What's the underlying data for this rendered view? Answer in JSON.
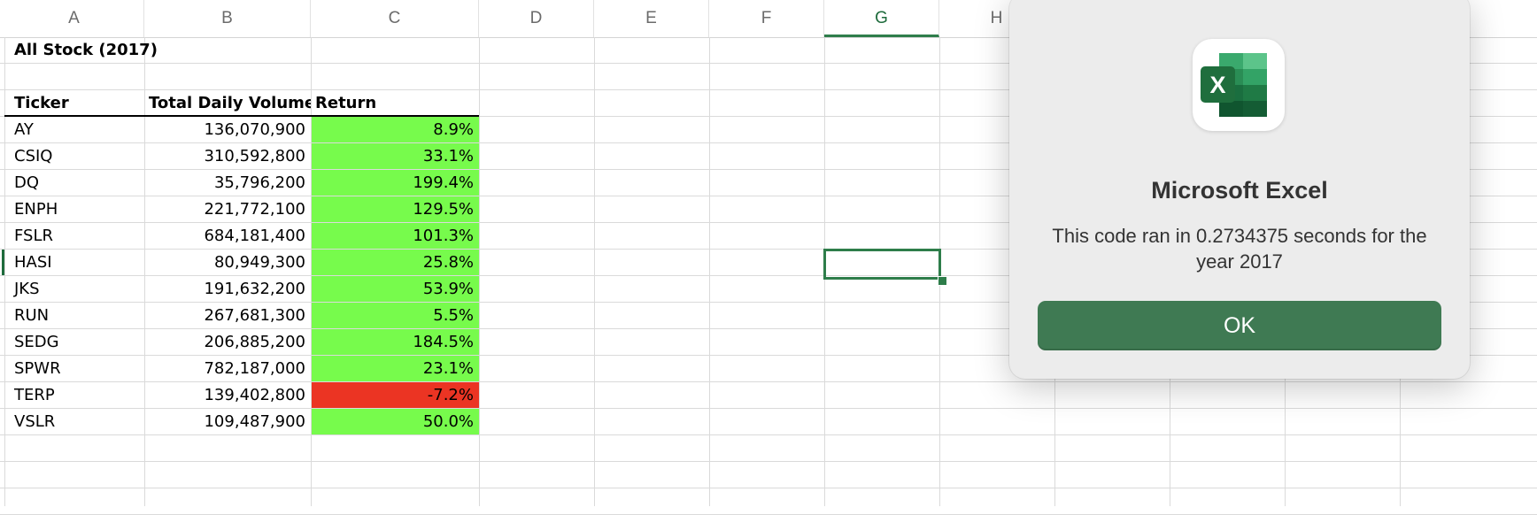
{
  "columns": [
    "A",
    "B",
    "C",
    "D",
    "E",
    "F",
    "G",
    "H"
  ],
  "active_column": "G",
  "sheet": {
    "title": "All Stock (2017)",
    "headers": {
      "ticker": "Ticker",
      "volume": "Total Daily Volume",
      "return": "Return"
    },
    "rows": [
      {
        "ticker": "AY",
        "volume": "136,070,900",
        "return": "8.9%",
        "status": "positive"
      },
      {
        "ticker": "CSIQ",
        "volume": "310,592,800",
        "return": "33.1%",
        "status": "positive"
      },
      {
        "ticker": "DQ",
        "volume": "35,796,200",
        "return": "199.4%",
        "status": "positive"
      },
      {
        "ticker": "ENPH",
        "volume": "221,772,100",
        "return": "129.5%",
        "status": "positive"
      },
      {
        "ticker": "FSLR",
        "volume": "684,181,400",
        "return": "101.3%",
        "status": "positive"
      },
      {
        "ticker": "HASI",
        "volume": "80,949,300",
        "return": "25.8%",
        "status": "positive"
      },
      {
        "ticker": "JKS",
        "volume": "191,632,200",
        "return": "53.9%",
        "status": "positive"
      },
      {
        "ticker": "RUN",
        "volume": "267,681,300",
        "return": "5.5%",
        "status": "positive"
      },
      {
        "ticker": "SEDG",
        "volume": "206,885,200",
        "return": "184.5%",
        "status": "positive"
      },
      {
        "ticker": "SPWR",
        "volume": "782,187,000",
        "return": "23.1%",
        "status": "positive"
      },
      {
        "ticker": "TERP",
        "volume": "139,402,800",
        "return": "-7.2%",
        "status": "negative"
      },
      {
        "ticker": "VSLR",
        "volume": "109,487,900",
        "return": "50.0%",
        "status": "positive"
      }
    ]
  },
  "colors": {
    "positive": "#77fb4c",
    "negative": "#eb3423",
    "accent": "#2e7d4a"
  },
  "dialog": {
    "icon": "excel-app-icon",
    "title": "Microsoft Excel",
    "message": "This code ran in 0.2734375 seconds for the year 2017",
    "ok_label": "OK"
  }
}
